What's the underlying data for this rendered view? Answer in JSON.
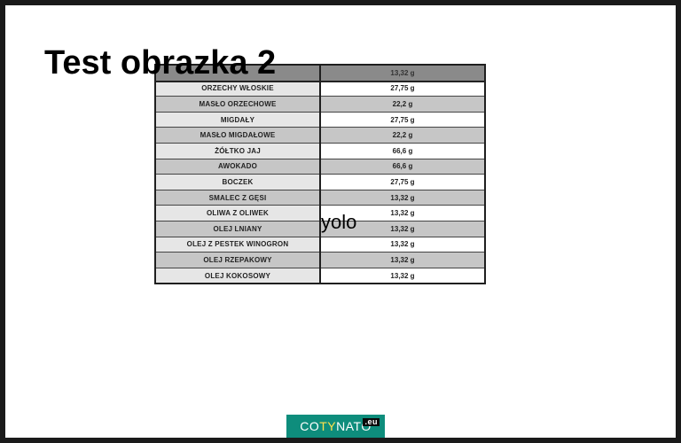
{
  "slide": {
    "title": "Test obrazka 2",
    "overlay_text": "yolo"
  },
  "table": {
    "rows": [
      {
        "name": "",
        "value": "13,32 g"
      },
      {
        "name": "ORZECHY WŁOSKIE",
        "value": "27,75 g"
      },
      {
        "name": "MASŁO ORZECHOWE",
        "value": "22,2 g"
      },
      {
        "name": "MIGDAŁY",
        "value": "27,75 g"
      },
      {
        "name": "MASŁO MIGDAŁOWE",
        "value": "22,2 g"
      },
      {
        "name": "ŻÓŁTKO JAJ",
        "value": "66,6 g"
      },
      {
        "name": "AWOKADO",
        "value": "66,6 g"
      },
      {
        "name": "BOCZEK",
        "value": "27,75 g"
      },
      {
        "name": "SMALEC Z GĘSI",
        "value": "13,32 g"
      },
      {
        "name": "OLIWA Z OLIWEK",
        "value": "13,32 g"
      },
      {
        "name": "OLEJ LNIANY",
        "value": "13,32 g"
      },
      {
        "name": "OLEJ Z PESTEK WINOGRON",
        "value": "13,32 g"
      },
      {
        "name": "OLEJ RZEPAKOWY",
        "value": "13,32 g"
      },
      {
        "name": "OLEJ KOKOSOWY",
        "value": "13,32 g"
      }
    ]
  },
  "logo": {
    "part1": "CO",
    "part2": "TY",
    "part3": "NATO",
    "tld": ".eu"
  }
}
